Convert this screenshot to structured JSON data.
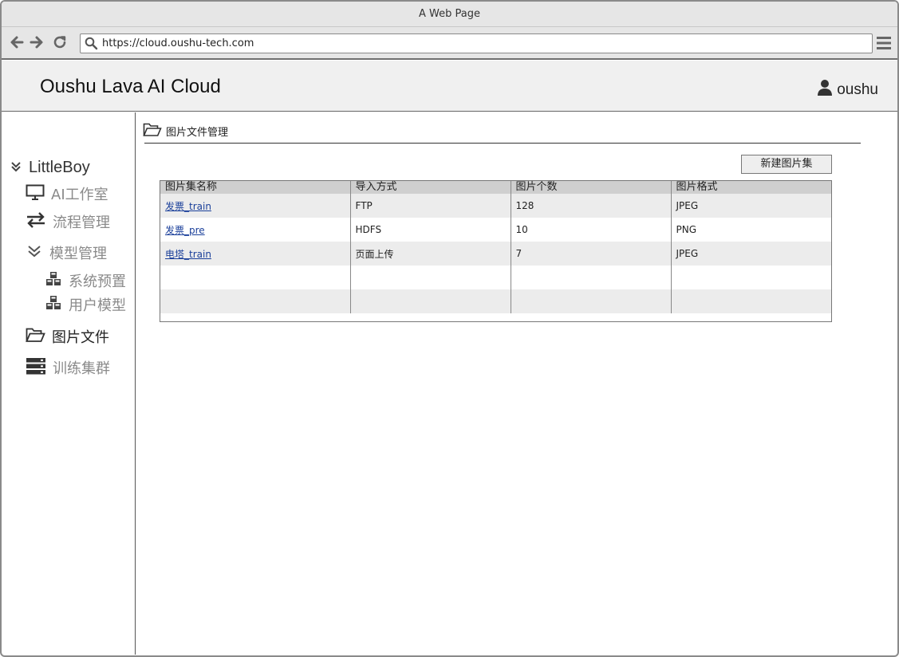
{
  "window": {
    "title": "A Web Page"
  },
  "browser": {
    "url": "https://cloud.oushu-tech.com"
  },
  "header": {
    "brand": "Oushu Lava AI Cloud",
    "user": "oushu"
  },
  "sidebar": {
    "root": "LittleBoy",
    "items": [
      {
        "label": "AI工作室",
        "icon": "monitor-icon"
      },
      {
        "label": "流程管理",
        "icon": "swap-arrows-icon"
      },
      {
        "label": "模型管理",
        "icon": "chevron-double-down-icon"
      },
      {
        "label": "系统预置",
        "icon": "cubes-icon"
      },
      {
        "label": "用户模型",
        "icon": "cubes-icon"
      },
      {
        "label": "图片文件",
        "icon": "folder-open-icon"
      },
      {
        "label": "训练集群",
        "icon": "server-icon"
      }
    ]
  },
  "main": {
    "breadcrumb": "图片文件管理",
    "new_button": "新建图片集",
    "table": {
      "columns": [
        "图片集名称",
        "导入方式",
        "图片个数",
        "图片格式"
      ],
      "rows": [
        [
          "发票_train",
          "FTP",
          "128",
          "JPEG"
        ],
        [
          "发票_pre",
          "HDFS",
          "10",
          "PNG"
        ],
        [
          "电塔_train",
          "页面上传",
          "7",
          "JPEG"
        ],
        [
          "",
          "",
          "",
          ""
        ],
        [
          "",
          "",
          "",
          ""
        ]
      ]
    }
  },
  "colors": {
    "link": "#1a3f9a",
    "header_bg": "#f0f0f0",
    "chrome_bg": "#e6e6e6"
  }
}
